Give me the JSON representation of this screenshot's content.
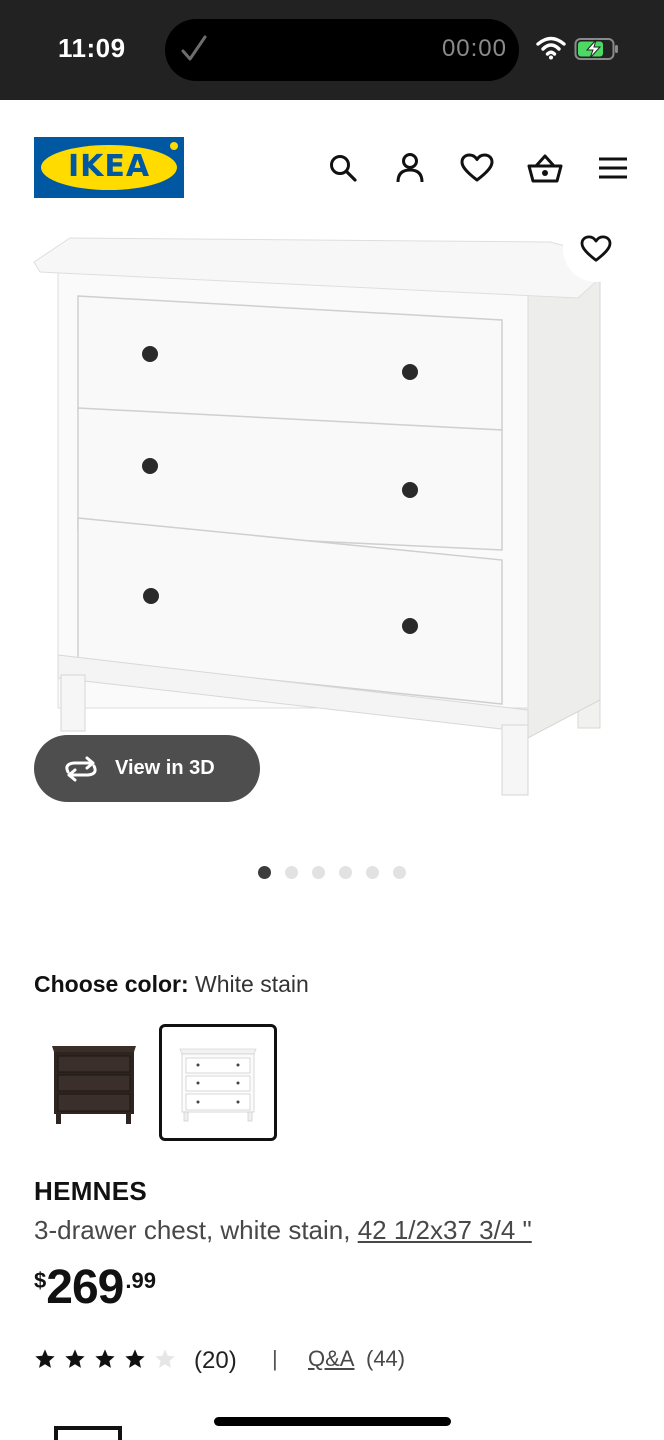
{
  "status_bar": {
    "time": "11:09",
    "timer": "00:00",
    "icons": [
      "check-icon",
      "wifi-icon",
      "battery-charging-icon"
    ]
  },
  "header": {
    "logo_text": "IKEA",
    "nav_icons": [
      "search-icon",
      "account-icon",
      "favorites-icon",
      "cart-icon",
      "menu-icon"
    ]
  },
  "gallery": {
    "view3d_label": "View in 3D",
    "slide_count": 6,
    "active_slide": 1
  },
  "color": {
    "label": "Choose color:",
    "value": "White stain",
    "options": [
      "black-brown",
      "white-stain"
    ],
    "selected": "white-stain"
  },
  "product": {
    "name": "HEMNES",
    "description": "3-drawer chest, white stain,",
    "dimensions": "42 1/2x37 3/4 \"",
    "price": {
      "currency": "$",
      "integer": "269",
      "decimal": ".99"
    }
  },
  "rating": {
    "stars": 4,
    "max_stars": 5,
    "review_count": "(20)",
    "separator": "|",
    "qa_label": "Q&A",
    "qa_count": "(44)"
  },
  "colors": {
    "status_bar_bg": "#222222",
    "logo_blue": "#0058a3",
    "logo_yellow": "#ffdb00",
    "view3d_bg": "#4e4e4e",
    "dark_swatch": "#2e2420"
  }
}
